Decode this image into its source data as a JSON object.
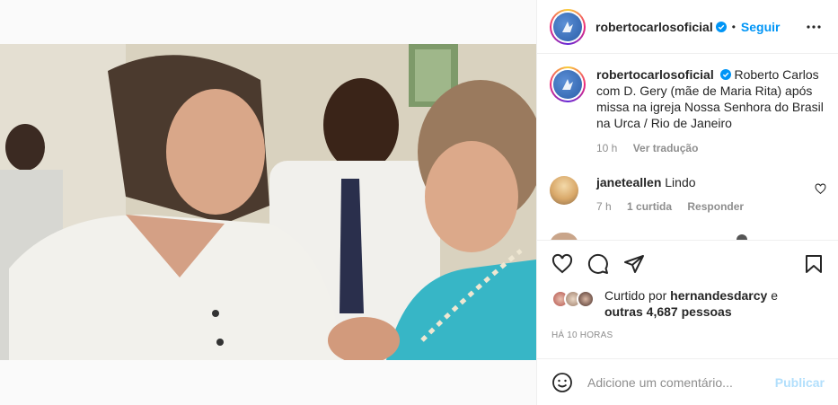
{
  "post": {
    "username": "robertocarlosoficial",
    "follow_label": "Seguir",
    "separator": "•",
    "caption": "Roberto Carlos com D. Gery (mãe de Maria Rita) após missa na igreja Nossa Senhora do Brasil na Urca / Rio de Janeiro",
    "caption_age": "10 h",
    "see_translation": "Ver tradução",
    "likes_prefix": "Curtido por ",
    "likes_user": "hernandesdarcy",
    "likes_mid": " e",
    "likes_others": "outras 4,687 pessoas",
    "timestamp": "HÁ 10 HORAS"
  },
  "comments": [
    {
      "username": "janeteallen",
      "text": "Lindo",
      "age": "7 h",
      "likes": "1 curtida",
      "reply_label": "Responder"
    }
  ],
  "add_comment": {
    "placeholder": "Adicione um comentário...",
    "publish_label": "Publicar"
  },
  "colors": {
    "accent": "#0095f6",
    "publish_disabled": "#b2dffc",
    "muted": "#8e8e8e",
    "text": "#262626"
  },
  "icons": [
    "more-icon",
    "verified-icon",
    "heart-icon",
    "comment-icon",
    "share-icon",
    "bookmark-icon",
    "emoji-icon"
  ]
}
